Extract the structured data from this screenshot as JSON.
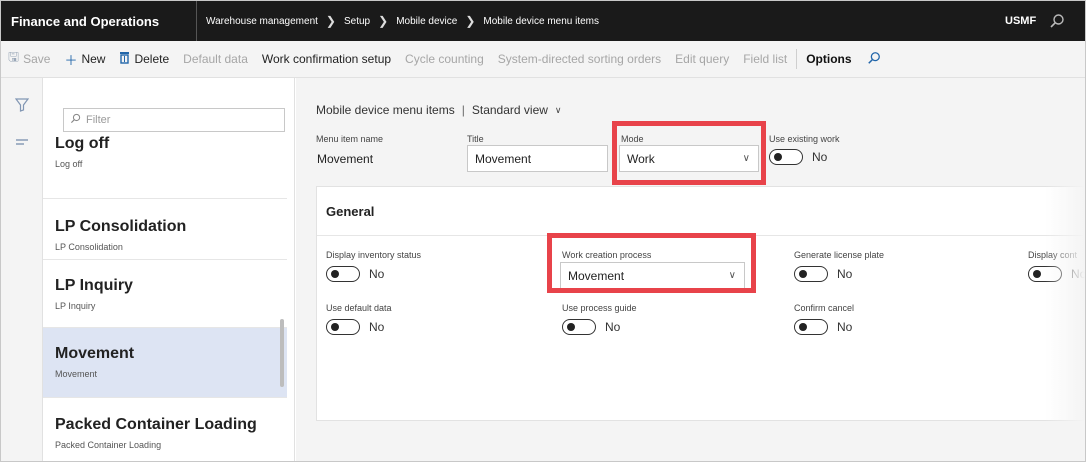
{
  "header": {
    "app_name": "Finance and Operations",
    "breadcrumbs": [
      "Warehouse management",
      "Setup",
      "Mobile device",
      "Mobile device menu items"
    ],
    "company": "USMF",
    "search_icon": "search-icon"
  },
  "actions": {
    "save": "Save",
    "new": "New",
    "delete": "Delete",
    "default_data": "Default data",
    "work_confirmation_setup": "Work confirmation setup",
    "cycle_counting": "Cycle counting",
    "system_directed_sorting_orders": "System-directed sorting orders",
    "edit_query": "Edit query",
    "field_list": "Field list",
    "options": "Options"
  },
  "list": {
    "filter_placeholder": "Filter",
    "items": [
      {
        "title": "Log off",
        "subtitle": "Log off"
      },
      {
        "title": "LP Consolidation",
        "subtitle": "LP Consolidation"
      },
      {
        "title": "LP Inquiry",
        "subtitle": "LP Inquiry"
      },
      {
        "title": "Movement",
        "subtitle": "Movement",
        "selected": true
      },
      {
        "title": "Packed Container Loading",
        "subtitle": "Packed Container Loading"
      }
    ]
  },
  "form": {
    "view_title": "Mobile device menu items",
    "view_name": "Standard view",
    "menu_item_name_label": "Menu item name",
    "menu_item_name_value": "Movement",
    "title_label": "Title",
    "title_value": "Movement",
    "mode_label": "Mode",
    "mode_value": "Work",
    "use_existing_work_label": "Use existing work",
    "use_existing_work_value": "No"
  },
  "general": {
    "header": "General",
    "display_inventory_status_label": "Display inventory status",
    "display_inventory_status_value": "No",
    "work_creation_process_label": "Work creation process",
    "work_creation_process_value": "Movement",
    "generate_license_plate_label": "Generate license plate",
    "generate_license_plate_value": "No",
    "display_cont_label": "Display cont",
    "display_cont_value": "No",
    "use_default_data_label": "Use default data",
    "use_default_data_value": "No",
    "use_process_guide_label": "Use process guide",
    "use_process_guide_value": "No",
    "confirm_cancel_label": "Confirm cancel",
    "confirm_cancel_value": "No"
  },
  "colors": {
    "highlight": "#e8434a",
    "topbar": "#1a1a1a",
    "selected_row": "#dde4f3",
    "accent": "#2266aa"
  }
}
